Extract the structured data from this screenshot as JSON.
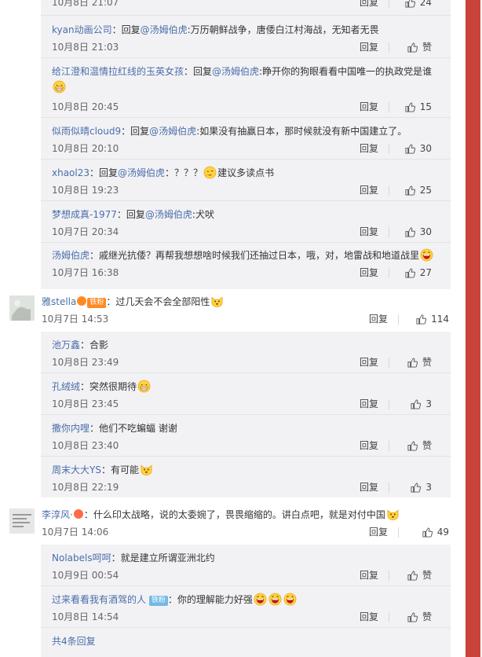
{
  "actions": {
    "reply": "回复",
    "like": "赞"
  },
  "top_partial": {
    "date": "10月8日 21:07",
    "reply": "回复",
    "likes": "24"
  },
  "thread1_replies": [
    {
      "user": "kyan动画公司",
      "prefix": "：回复",
      "at": "@汤姆伯虎",
      "text": ":万历朝鲜战争，唐倭白江村海战，无知者无畏",
      "date": "10月8日 21:03",
      "likes": "赞"
    },
    {
      "user": "给江澄和温情拉红线的玉英女孩",
      "prefix": "：回复",
      "at": "@汤姆伯虎",
      "text": ":睁开你的狗眼看看中国唯一的执政党是谁",
      "date": "10月8日 20:45",
      "likes": "15"
    },
    {
      "user": "似雨似晴cloud9",
      "prefix": "：回复",
      "at": "@汤姆伯虎",
      "text": ":如果没有抽赢日本，那时候就没有新中国建立了。",
      "date": "10月8日 20:10",
      "likes": "30"
    },
    {
      "user": "xhaol23",
      "prefix": "：回复",
      "at": "@汤姆伯虎",
      "text": "：？？？",
      "text2": "建议多读点书",
      "date": "10月8日 19:23",
      "likes": "25"
    },
    {
      "user": "梦想成真-1977",
      "prefix": "：回复",
      "at": "@汤姆伯虎",
      "text": ":犬吠",
      "date": "10月7日 20:34",
      "likes": "30"
    },
    {
      "user": "汤姆伯虎",
      "prefix": "：",
      "text": "戚继光抗倭？再帮我想想啥时候我们还抽过日本，哦，对，地雷战和地道战里",
      "date": "10月7日 16:38",
      "likes": "27"
    }
  ],
  "comment2": {
    "user": "雅stella",
    "badge": "铁粉",
    "text": "：过几天会不会全部阳性",
    "date": "10月7日 14:53",
    "likes": "114",
    "replies": [
      {
        "user": "池万鑫",
        "text": "：合影",
        "date": "10月8日 23:49",
        "likes": "赞"
      },
      {
        "user": "孔绒绒",
        "text": "：突然很期待",
        "date": "10月8日 23:45",
        "likes": "3"
      },
      {
        "user": "撒你内哩",
        "text": "：他们不吃蝙蝠 谢谢",
        "date": "10月8日 23:40",
        "likes": "赞"
      },
      {
        "user": "周末大大YS",
        "text": "：有可能",
        "date": "10月8日 22:19",
        "likes": "3"
      }
    ]
  },
  "comment3": {
    "user": "李淳风·",
    "text": "：什么印太战略，说的太委婉了，畏畏缩缩的。讲白点吧，就是对付中国",
    "date": "10月7日 14:06",
    "likes": "49",
    "replies": [
      {
        "user": "Nolabels呵呵",
        "text": "：就是建立所谓亚洲北约",
        "date": "10月9日 00:54",
        "likes": "赞"
      },
      {
        "user": "过来看看我有酒驾的人",
        "badge": "铁粉",
        "text": "：你的理解能力好强",
        "date": "10月8日 14:54",
        "likes": "赞"
      }
    ],
    "more": "共4条回复"
  },
  "colors": {
    "link": "#4a6ea9",
    "reply_bg": "#f2f2f5",
    "side_red": "#c9433a",
    "badge_orange": "#ff8a22",
    "badge_blue": "#74b9e5"
  }
}
